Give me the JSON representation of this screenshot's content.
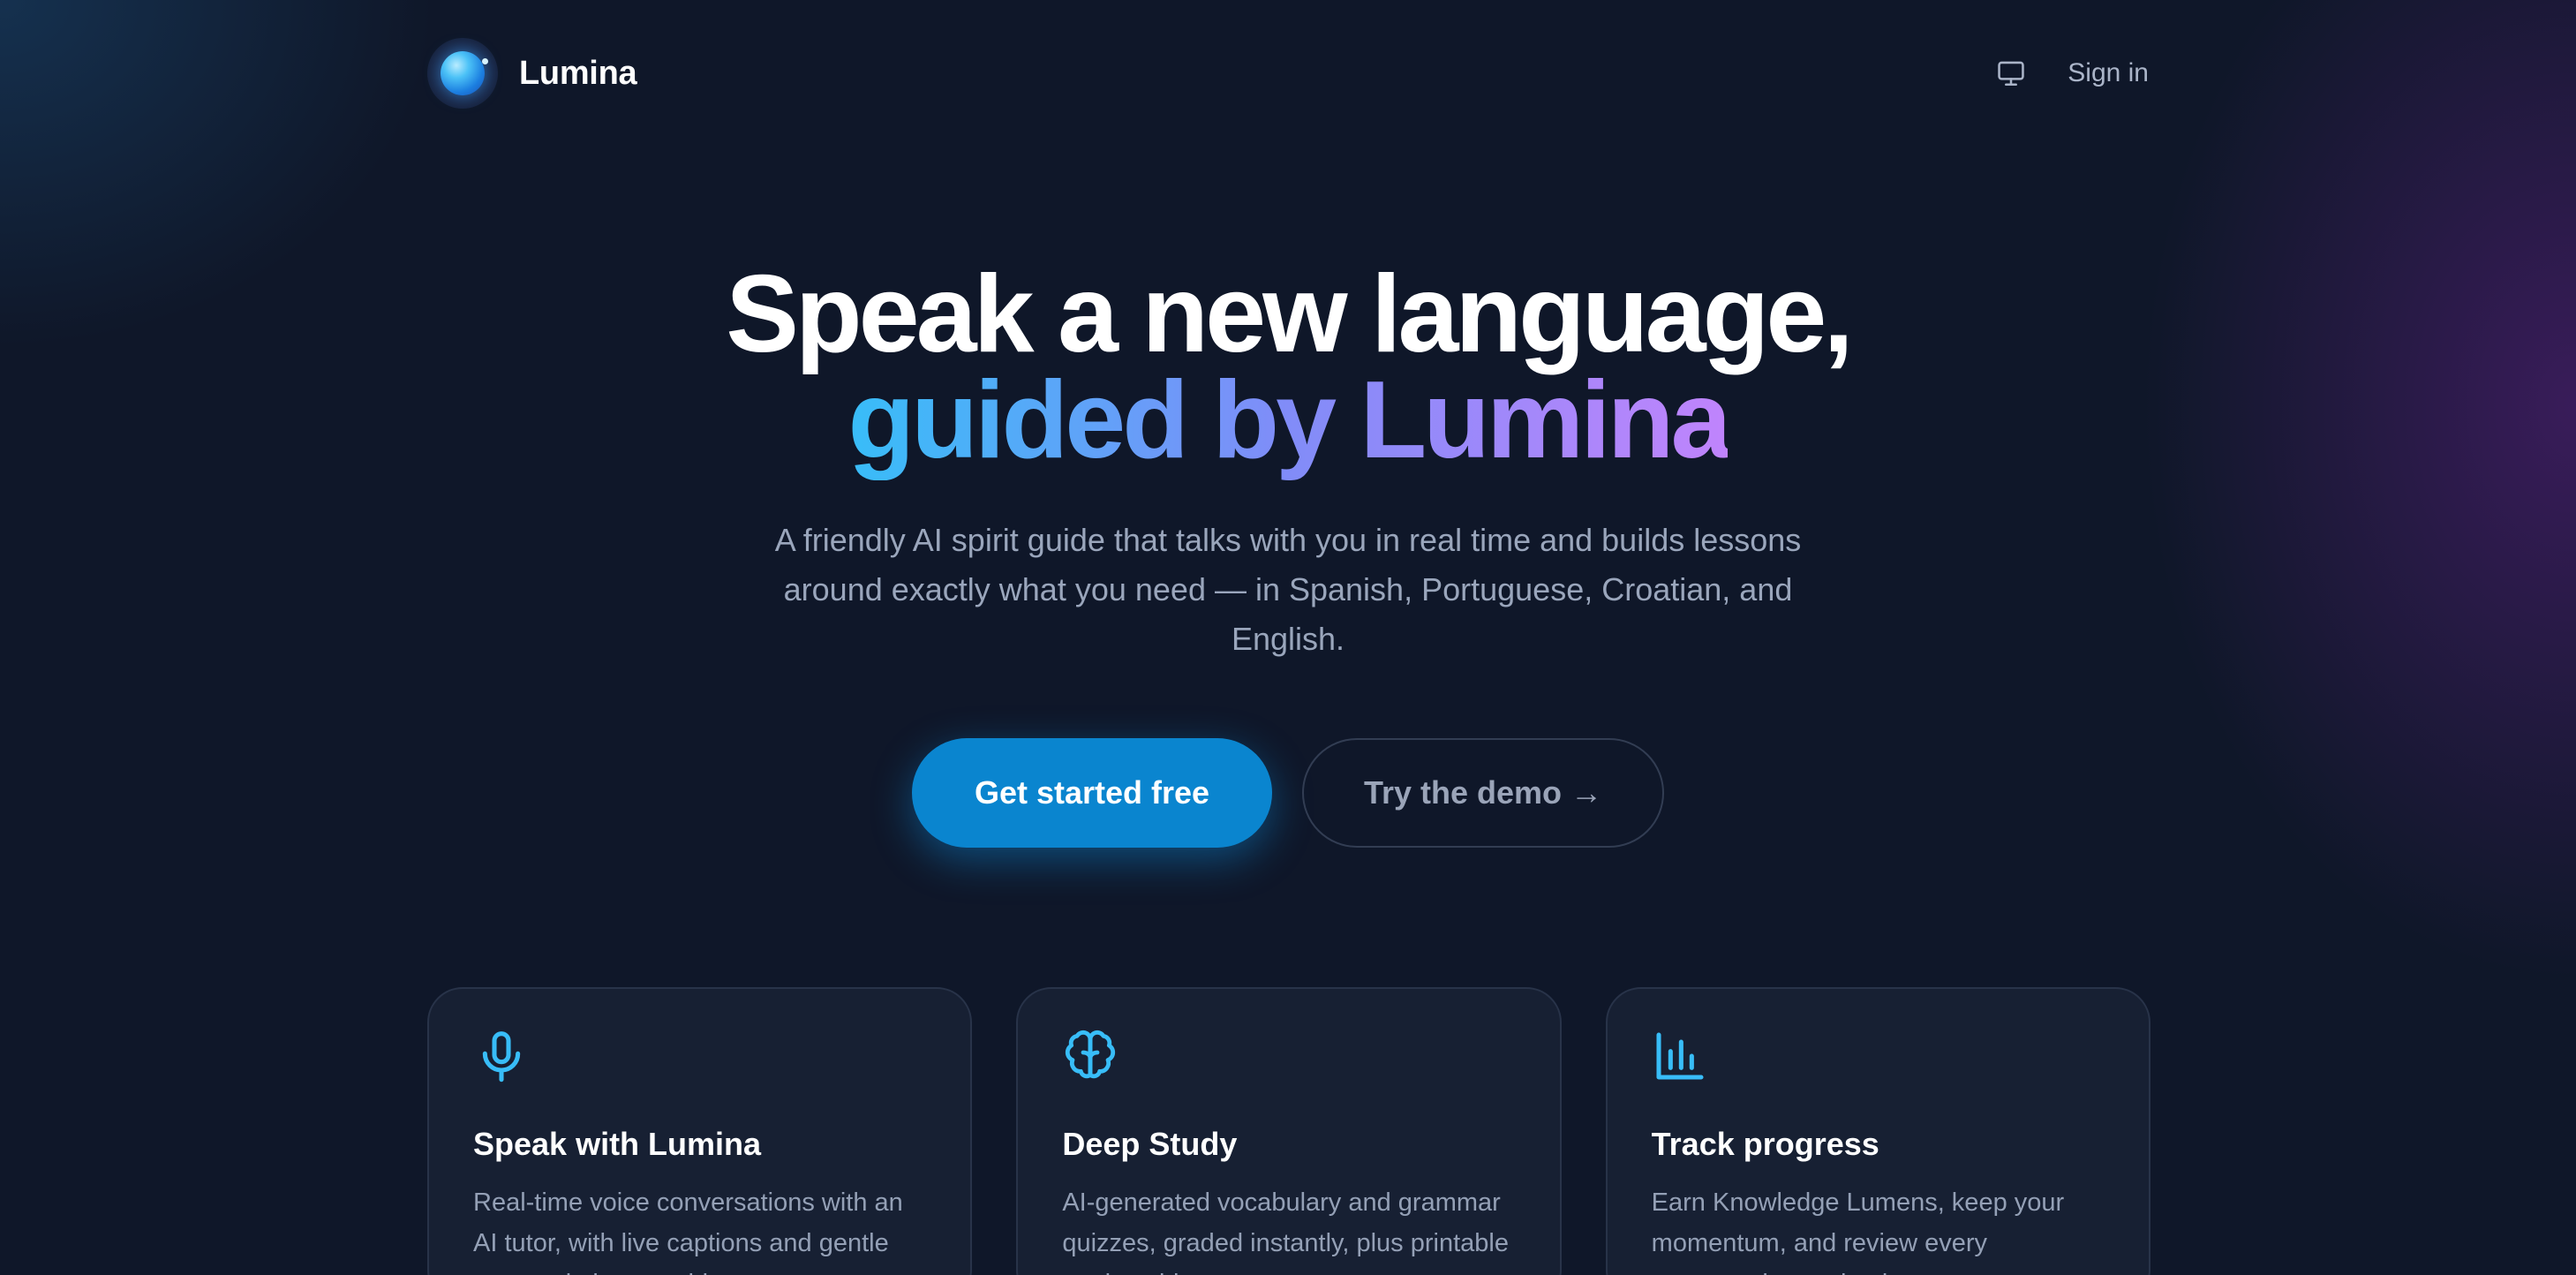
{
  "header": {
    "brand_name": "Lumina",
    "theme_icon": "monitor-icon",
    "signin_label": "Sign in"
  },
  "hero": {
    "headline_line1": "Speak a new language,",
    "headline_line2": "guided by Lumina",
    "subtitle": "A friendly AI spirit guide that talks with you in real time and builds lessons around exactly what you need — in Spanish, Portuguese, Croatian, and English.",
    "primary_cta": "Get started free",
    "secondary_cta": "Try the demo →"
  },
  "features": [
    {
      "icon": "microphone-icon",
      "title": "Speak with Lumina",
      "description": "Real-time voice conversations with an AI tutor, with live captions and gentle pronunciation coaching."
    },
    {
      "icon": "brain-icon",
      "title": "Deep Study",
      "description": "AI-generated vocabulary and grammar quizzes, graded instantly, plus printable study guides."
    },
    {
      "icon": "bar-chart-icon",
      "title": "Track progress",
      "description": "Earn Knowledge Lumens, keep your momentum, and review every conversation and quiz."
    }
  ],
  "colors": {
    "background": "#0f1729",
    "accent": "#0a85cf",
    "icon": "#38bdf8",
    "gradient_start": "#38bdf8",
    "gradient_end": "#c084fc"
  }
}
